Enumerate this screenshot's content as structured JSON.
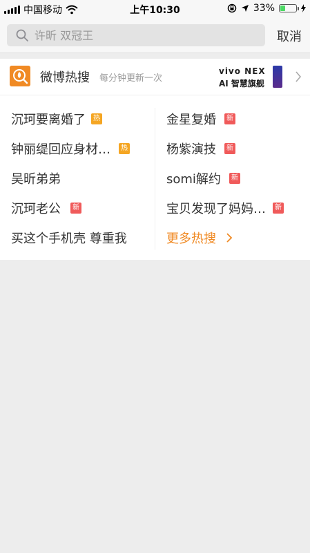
{
  "status_bar": {
    "carrier": "中国移动",
    "time": "上午10:30",
    "battery": "33%",
    "battery_level": 0.33
  },
  "search": {
    "placeholder": "许昕 双冠王",
    "cancel_label": "取消"
  },
  "hot_search": {
    "title": "微博热搜",
    "subtitle": "每分钟更新一次",
    "ad_line1": "vivo NEX",
    "ad_line2": "AI 智慧旗舰",
    "left_items": [
      {
        "text": "沉珂要离婚了",
        "badge": "热",
        "badge_type": "hot"
      },
      {
        "text": "钟丽缇回应身材…",
        "badge": "热",
        "badge_type": "hot"
      },
      {
        "text": "吴昕弟弟",
        "badge": "",
        "badge_type": ""
      },
      {
        "text": "沉珂老公",
        "badge": "新",
        "badge_type": "new"
      },
      {
        "text": "买这个手机壳 尊重我",
        "badge": "",
        "badge_type": ""
      }
    ],
    "right_items": [
      {
        "text": "金星复婚",
        "badge": "新",
        "badge_type": "new"
      },
      {
        "text": "杨紫演技",
        "badge": "新",
        "badge_type": "new"
      },
      {
        "text": "somi解约",
        "badge": "新",
        "badge_type": "new"
      },
      {
        "text": "宝贝发现了妈妈…",
        "badge": "新",
        "badge_type": "new"
      }
    ],
    "more_label": "更多热搜"
  },
  "colors": {
    "accent": "#f08a24",
    "hot_badge": "#f5a623",
    "new_badge": "#f05a5a",
    "battery_fill": "#4cd964"
  }
}
